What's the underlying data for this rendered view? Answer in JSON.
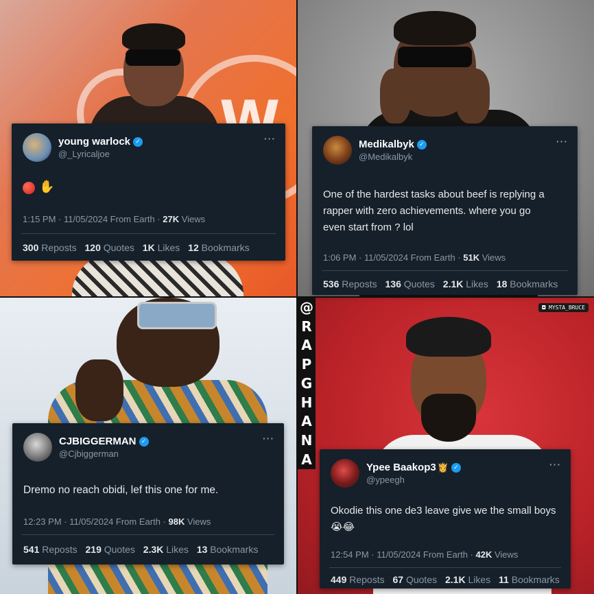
{
  "watermark": {
    "letters": [
      "@",
      "R",
      "A",
      "P",
      "G",
      "H",
      "A",
      "N",
      "A"
    ],
    "insta_tag": "MYSTA_BRUCE"
  },
  "colors": {
    "card_bg": "#15202b",
    "verified": "#1d9bf0",
    "muted": "#8b98a5"
  },
  "tweets": [
    {
      "name": "young warlock",
      "handle": "@_Lyricaljoe",
      "verified": true,
      "text": "🔴 🤚",
      "time": "1:15 PM · 11/05/2024 From Earth · ",
      "views_count": "27K",
      "views_label": "Views",
      "reposts_count": "300",
      "reposts_label": "Reposts",
      "quotes_count": "120",
      "quotes_label": "Quotes",
      "likes_count": "1K",
      "likes_label": "Likes",
      "bookmarks_count": "12",
      "bookmarks_label": "Bookmarks"
    },
    {
      "name": "Medikalbyk",
      "handle": "@Medikalbyk",
      "verified": true,
      "text_lines": [
        "One of the hardest tasks about beef is replying a",
        "rapper with zero achievements. where you go",
        "even start from ? lol"
      ],
      "time": "1:06 PM · 11/05/2024 From Earth · ",
      "views_count": "51K",
      "views_label": "Views",
      "reposts_count": "536",
      "reposts_label": "Reposts",
      "quotes_count": "136",
      "quotes_label": "Quotes",
      "likes_count": "2.1K",
      "likes_label": "Likes",
      "bookmarks_count": "18",
      "bookmarks_label": "Bookmarks"
    },
    {
      "name": "CJBIGGERMAN",
      "handle": "@Cjbiggerman",
      "verified": true,
      "text": "Dremo no reach obidi, lef this one for me.",
      "time": "12:23 PM · 11/05/2024 From Earth · ",
      "views_count": "98K",
      "views_label": "Views",
      "reposts_count": "541",
      "reposts_label": "Reposts",
      "quotes_count": "219",
      "quotes_label": "Quotes",
      "likes_count": "2.3K",
      "likes_label": "Likes",
      "bookmarks_count": "13",
      "bookmarks_label": "Bookmarks"
    },
    {
      "name": "Ypee Baakop3",
      "handle": "@ypeegh",
      "verified": true,
      "crown": "👸",
      "text_lines": [
        "Okodie this one de3 leave give we the small boys",
        "😭😂"
      ],
      "time": "12:54 PM · 11/05/2024 From Earth · ",
      "views_count": "42K",
      "views_label": "Views",
      "reposts_count": "449",
      "reposts_label": "Reposts",
      "quotes_count": "67",
      "quotes_label": "Quotes",
      "likes_count": "2.1K",
      "likes_label": "Likes",
      "bookmarks_count": "11",
      "bookmarks_label": "Bookmarks"
    }
  ]
}
